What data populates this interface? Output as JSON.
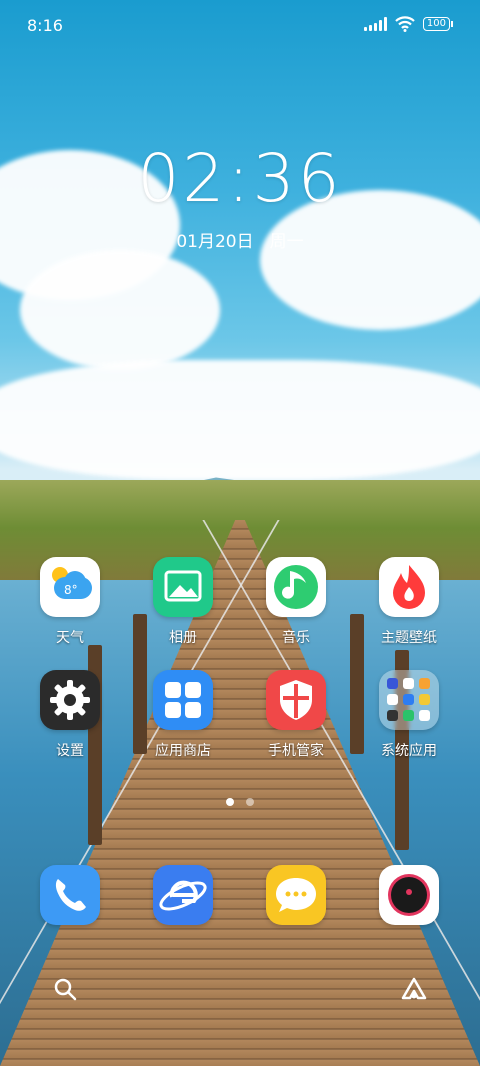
{
  "status_bar": {
    "time": "8:16",
    "battery": "100"
  },
  "lock_clock": {
    "time": "02:36",
    "date": "01月20日",
    "weekday": "周一"
  },
  "apps_row1": [
    {
      "label": "天气",
      "icon": "weather-icon",
      "weather_temp": "8°"
    },
    {
      "label": "相册",
      "icon": "gallery-icon"
    },
    {
      "label": "音乐",
      "icon": "music-icon"
    },
    {
      "label": "主题壁纸",
      "icon": "theme-wallpaper-icon"
    }
  ],
  "apps_row2": [
    {
      "label": "设置",
      "icon": "settings-icon"
    },
    {
      "label": "应用商店",
      "icon": "app-store-icon"
    },
    {
      "label": "手机管家",
      "icon": "phone-manager-icon"
    },
    {
      "label": "系统应用",
      "icon": "system-apps-folder-icon"
    }
  ],
  "page_indicator": {
    "total": 2,
    "current": 1
  },
  "dock": [
    {
      "icon": "phone-icon"
    },
    {
      "icon": "browser-icon"
    },
    {
      "icon": "messages-icon"
    },
    {
      "icon": "camera-icon"
    }
  ],
  "bottom_bar": {
    "left_icon": "search-icon",
    "right_icon": "assistant-icon"
  },
  "colors": {
    "gallery": "#20c98a",
    "music_note": "#2ecc71",
    "theme": "#ff3b3b",
    "settings": "#2b2b2b",
    "app_store": "#2f8df5",
    "phone_manager": "#f04848",
    "phone": "#3d9af5",
    "browser": "#3a7df0",
    "messages": "#f9c623",
    "camera_ring": "#e2355e"
  }
}
